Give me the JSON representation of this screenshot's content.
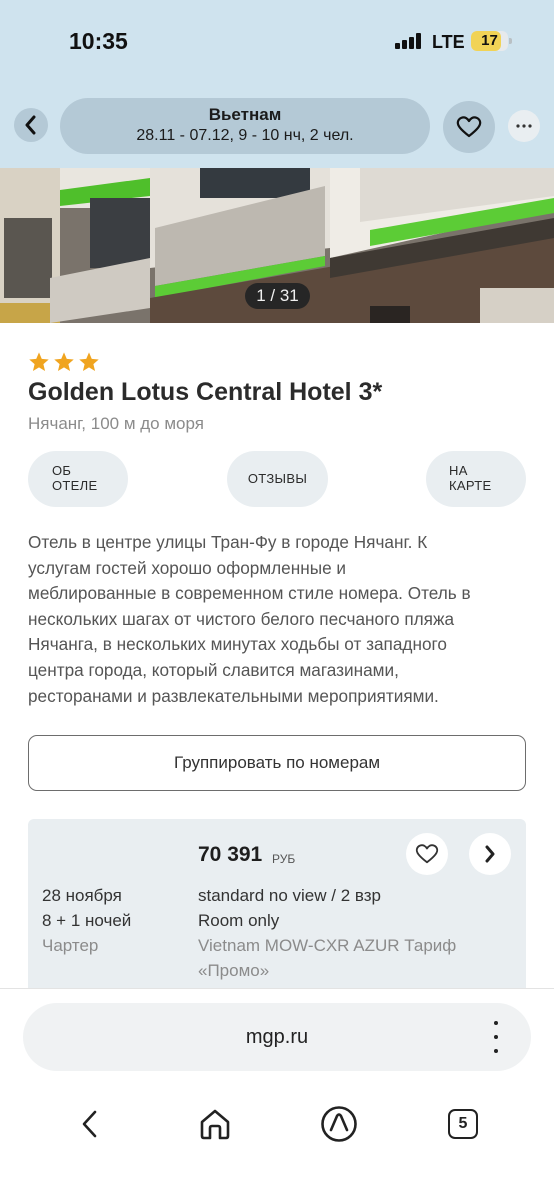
{
  "status": {
    "time": "10:35",
    "network": "LTE",
    "battery": "17",
    "battery_level": 0.17
  },
  "header": {
    "title": "Вьетнам",
    "subtitle": "28.11 - 07.12, 9 - 10 нч, 2 чел."
  },
  "gallery": {
    "counter": "1 / 31"
  },
  "hotel": {
    "stars": 3,
    "name": "Golden Lotus Central Hotel 3*",
    "location": "Нячанг, 100 м до моря",
    "tabs": {
      "about_l1": "ОБ",
      "about_l2": "ОТЕЛЕ",
      "reviews": "ОТЗЫВЫ",
      "map_l1": "НА",
      "map_l2": "КАРТЕ"
    },
    "description": [
      "Отель в центре улицы Тран-Фу в городе Нячанг. К",
      "услугам гостей хорошо оформленные и",
      "меблированные в современном стиле номера. Отель в",
      "нескольких шагах от чистого белого песчаного пляжа",
      "Нячанга, в нескольких минутах ходьбы от западного",
      "центра города, который славится магазинами,",
      "ресторанами и развлекательными мероприятиями."
    ],
    "group_button": "Группировать по номерам"
  },
  "offer": {
    "price": "70 391",
    "currency": "РУБ",
    "date": "28 ноября",
    "nights": "8 + 1 ночей",
    "flight": "Чартер",
    "room": "standard no view / 2 взр",
    "meal": "Room only",
    "tariff_l1": "Vietnam MOW-CXR AZUR Тариф",
    "tariff_l2": "«Промо»"
  },
  "browser": {
    "url": "mgp.ru",
    "tab_count": "5"
  },
  "colors": {
    "accent_bg": "#cfe3ee",
    "pill_bg": "#b4c9d6",
    "star": "#f0a41f",
    "card_bg": "#e9eef1"
  }
}
